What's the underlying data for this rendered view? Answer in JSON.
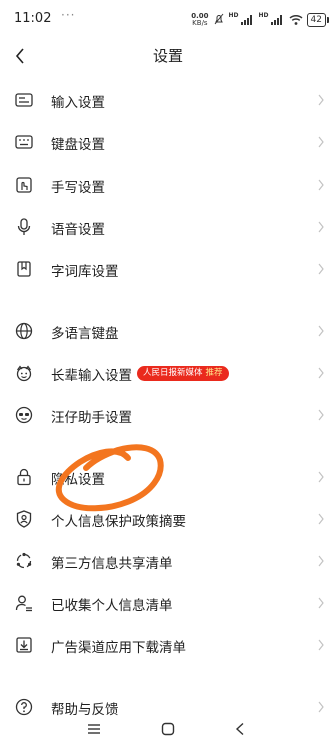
{
  "status_bar": {
    "time": "11:02",
    "dots": "···",
    "net_speed_value": "0.00",
    "net_speed_unit": "KB/s",
    "hd_label": "HD",
    "battery": "42"
  },
  "header": {
    "title": "设置"
  },
  "settings_items": [
    {
      "label": "输入设置",
      "icon": "input-icon"
    },
    {
      "label": "键盘设置",
      "icon": "keyboard-icon"
    },
    {
      "label": "手写设置",
      "icon": "handwriting-icon"
    },
    {
      "label": "语音设置",
      "icon": "microphone-icon"
    },
    {
      "label": "字词库设置",
      "icon": "dictionary-icon"
    },
    {
      "label": "多语言键盘",
      "icon": "globe-icon"
    },
    {
      "label": "长辈输入设置",
      "icon": "elder-face-icon",
      "badge": {
        "text": "人民日报新媒体",
        "highlight": "推荐"
      }
    },
    {
      "label": "汪仔助手设置",
      "icon": "assistant-icon"
    },
    {
      "label": "隐私设置",
      "icon": "lock-icon"
    },
    {
      "label": "个人信息保护政策摘要",
      "icon": "shield-user-icon"
    },
    {
      "label": "第三方信息共享清单",
      "icon": "share-cycle-icon"
    },
    {
      "label": "已收集个人信息清单",
      "icon": "user-list-icon"
    },
    {
      "label": "广告渠道应用下载清单",
      "icon": "download-icon"
    },
    {
      "label": "帮助与反馈",
      "icon": "help-icon"
    }
  ],
  "colors": {
    "badge_bg": "#ea2a1d",
    "scribble": "#f3751f",
    "chevron": "#c2c2c2"
  }
}
